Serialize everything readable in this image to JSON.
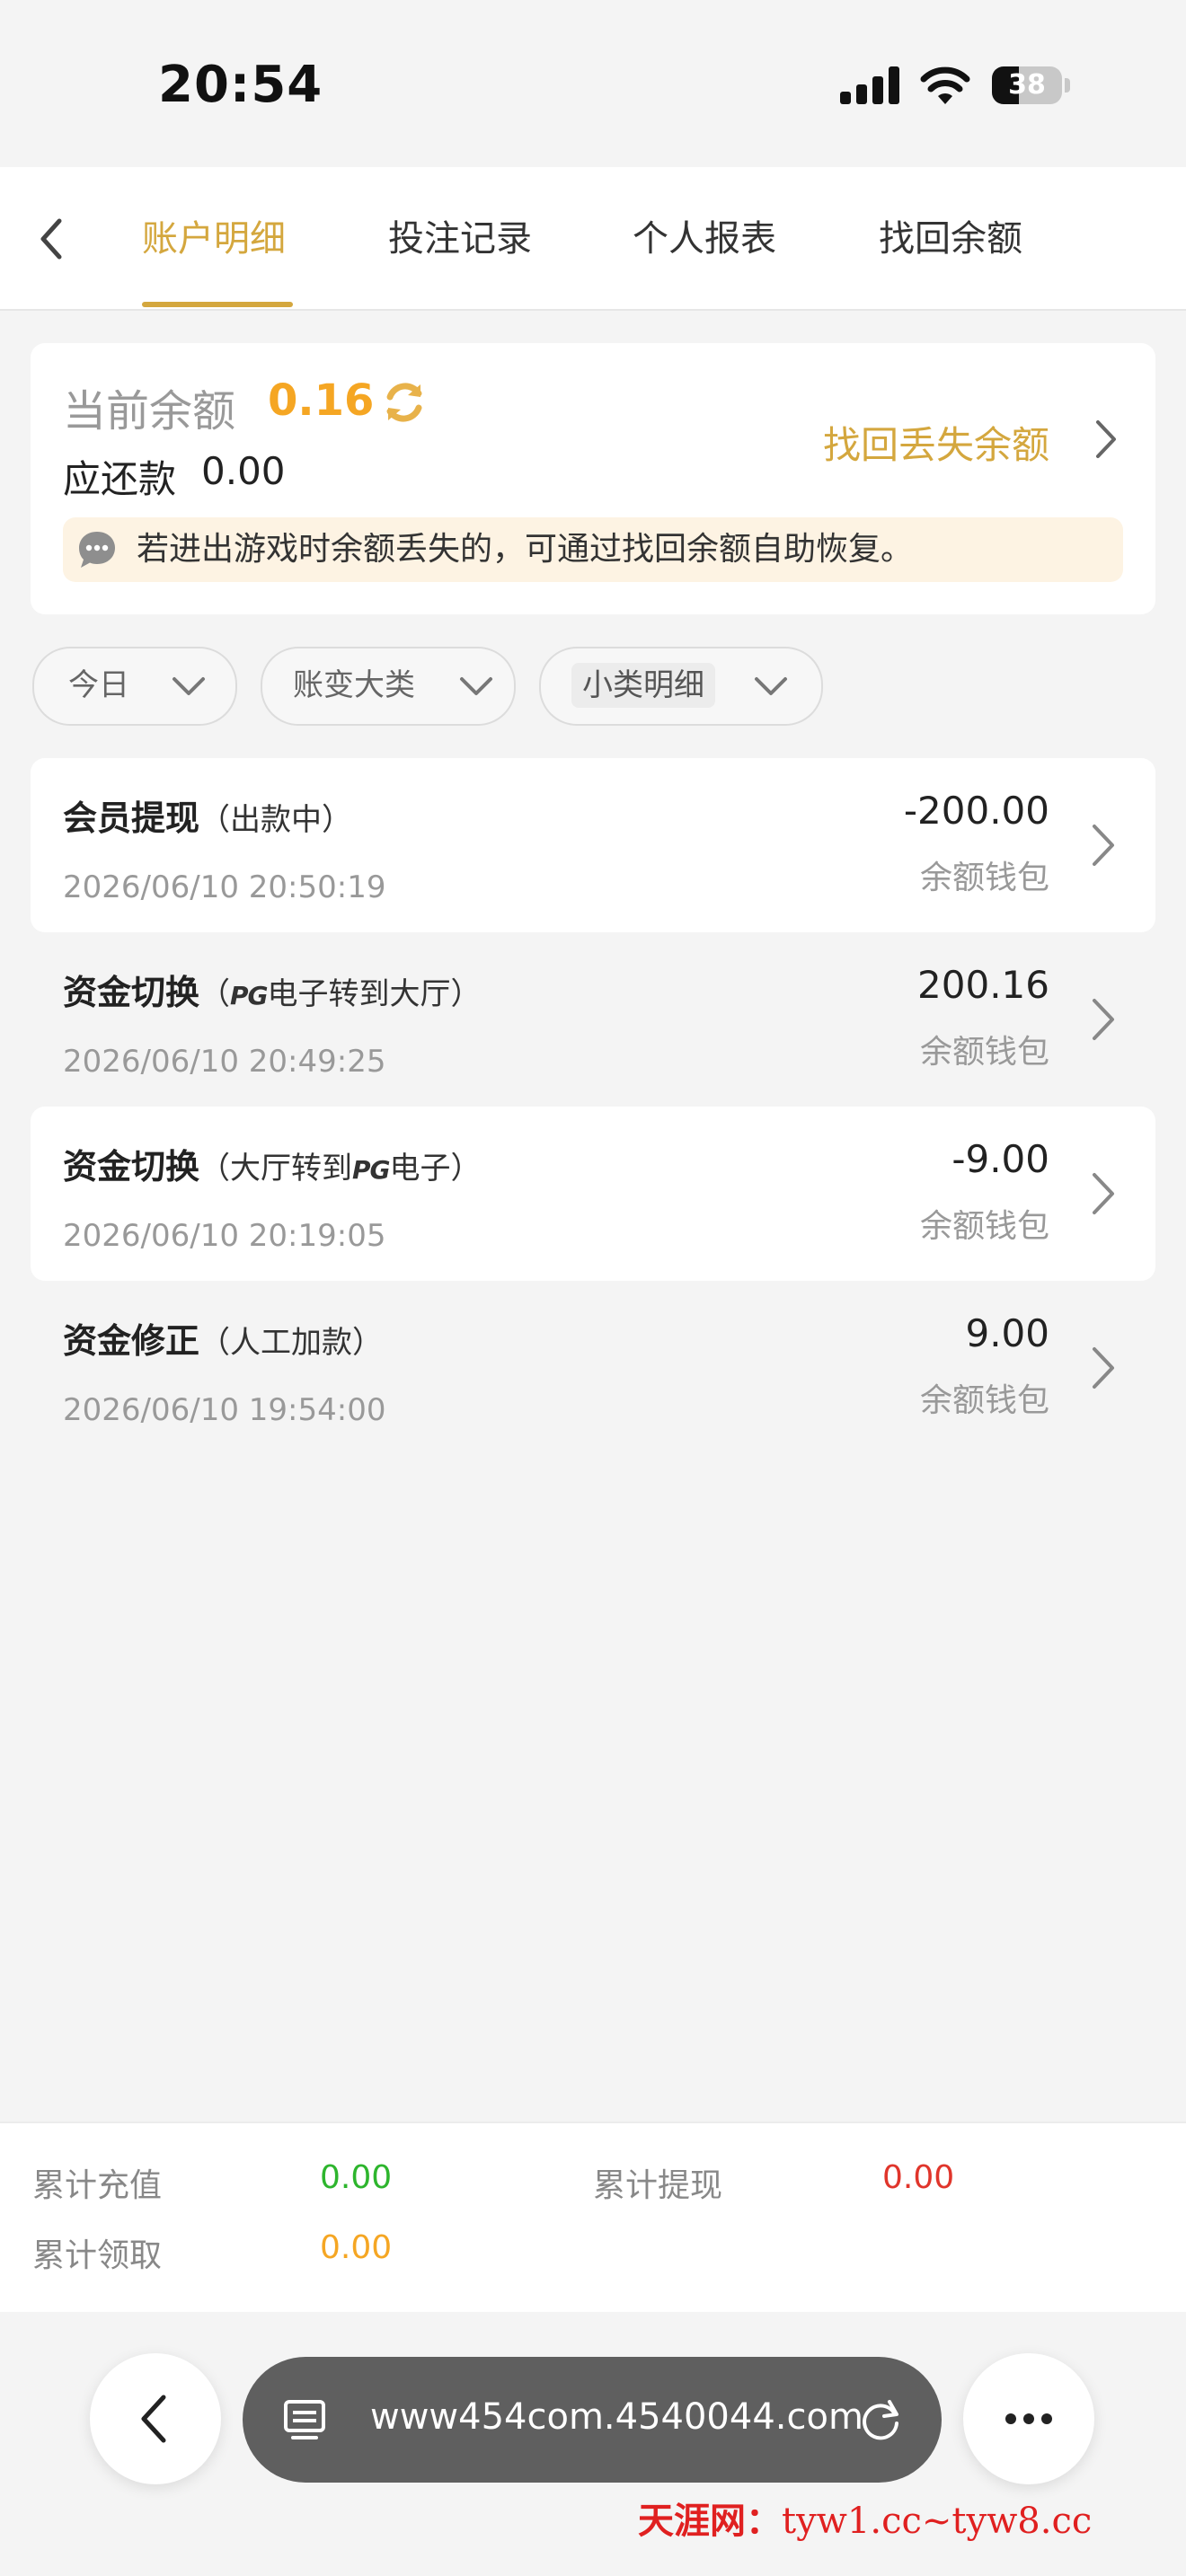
{
  "status_bar": {
    "time": "20:54",
    "battery": "38",
    "battery_level": 0.38
  },
  "nav": {
    "tabs": [
      {
        "label": "账户明细",
        "active": true
      },
      {
        "label": "投注记录",
        "active": false
      },
      {
        "label": "个人报表",
        "active": false
      },
      {
        "label": "找回余额",
        "active": false
      }
    ]
  },
  "balance": {
    "label": "当前余额",
    "value": "0.16",
    "due_label": "应还款",
    "due_value": "0.00",
    "recover_link": "找回丢失余额",
    "notice": "若进出游戏时余额丢失的，可通过找回余额自助恢复。"
  },
  "filters": [
    {
      "label": "今日"
    },
    {
      "label": "账变大类"
    },
    {
      "label": "小类明细"
    }
  ],
  "transactions": [
    {
      "title": "会员提现",
      "sub_pre": "（出款中）",
      "sub_pg": "",
      "sub_post": "",
      "time": "2026/06/10 20:50:19",
      "amount": "-200.00",
      "wallet": "余额钱包"
    },
    {
      "title": "资金切换",
      "sub_pre": "（",
      "sub_pg": "PG",
      "sub_post": "电子转到大厅）",
      "time": "2026/06/10 20:49:25",
      "amount": "200.16",
      "wallet": "余额钱包"
    },
    {
      "title": "资金切换",
      "sub_pre": "（大厅转到",
      "sub_pg": "PG",
      "sub_post": "电子）",
      "time": "2026/06/10 20:19:05",
      "amount": "-9.00",
      "wallet": "余额钱包"
    },
    {
      "title": "资金修正",
      "sub_pre": "（人工加款）",
      "sub_pg": "",
      "sub_post": "",
      "time": "2026/06/10 19:54:00",
      "amount": "9.00",
      "wallet": "余额钱包"
    }
  ],
  "totals": {
    "recharge_label": "累计充值",
    "recharge_value": "0.00",
    "withdraw_label": "累计提现",
    "withdraw_value": "0.00",
    "claim_label": "累计领取",
    "claim_value": "0.00"
  },
  "browser": {
    "url": "www454com.4540044.com"
  },
  "watermark": {
    "brand": "天涯网：",
    "domains": "tyw1.cc~tyw8.cc"
  },
  "colors": {
    "accent": "#d4a73e",
    "balance": "#f5a623",
    "green": "#2db52d",
    "red": "#e0352b",
    "orange": "#f5a623"
  }
}
